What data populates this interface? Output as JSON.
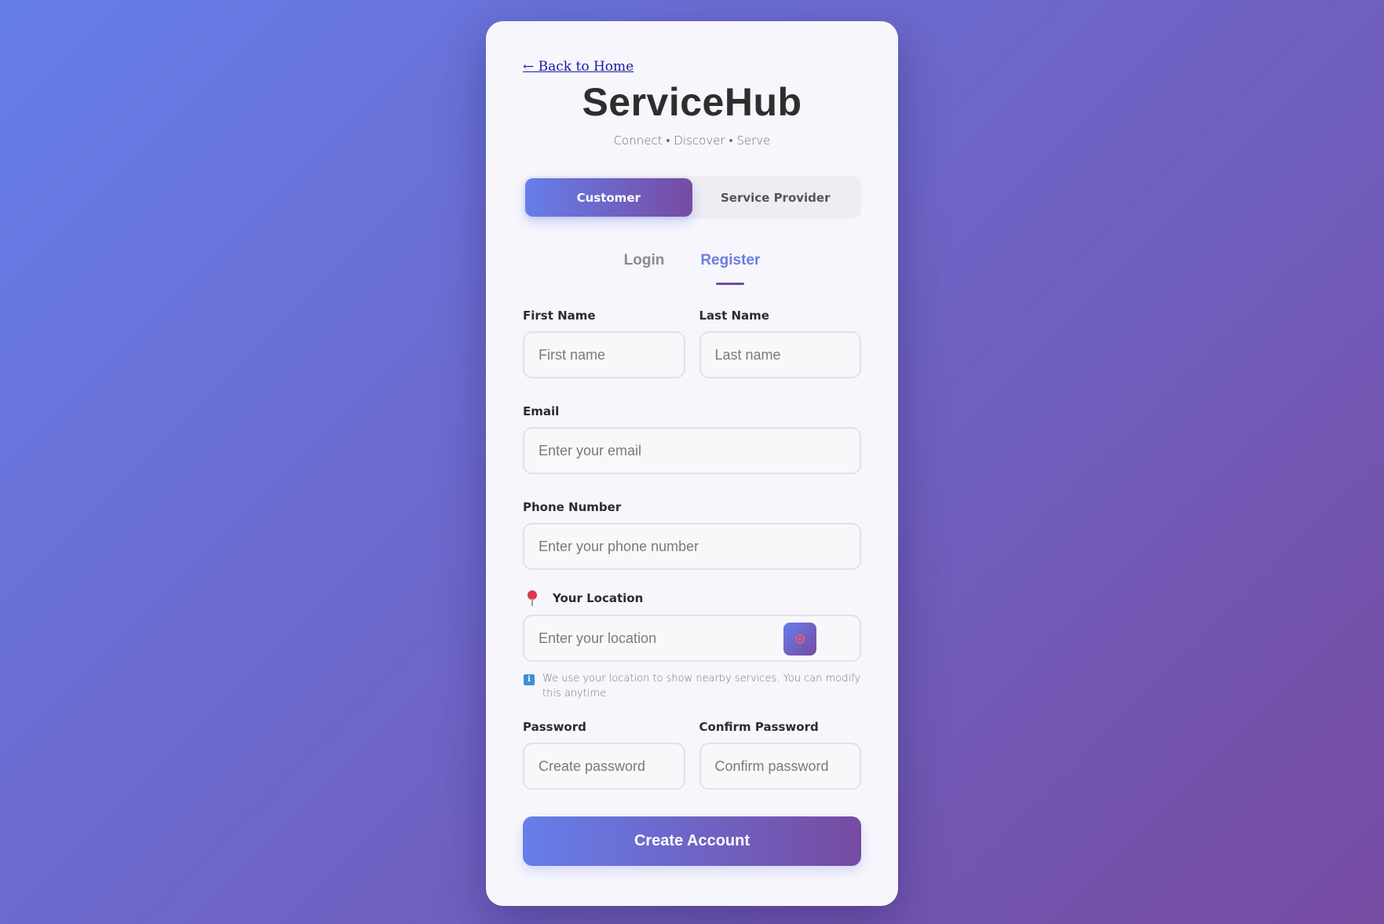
{
  "nav": {
    "back_label": "← Back to Home"
  },
  "brand": {
    "name": "ServiceHub",
    "tagline": "Connect • Discover • Serve"
  },
  "role_toggle": {
    "options": [
      "Customer",
      "Service Provider"
    ],
    "selected": "Customer"
  },
  "auth_tabs": {
    "options": [
      "Login",
      "Register"
    ],
    "selected": "Register"
  },
  "form": {
    "first_name": {
      "label": "First Name",
      "placeholder": "First name"
    },
    "last_name": {
      "label": "Last Name",
      "placeholder": "Last name"
    },
    "email": {
      "label": "Email",
      "placeholder": "Enter your email"
    },
    "phone": {
      "label": "Phone Number",
      "placeholder": "Enter your phone number"
    },
    "location": {
      "label": "Your Location",
      "placeholder": "Enter your location",
      "hint": "We use your location to show nearby services. You can modify this anytime."
    },
    "password": {
      "label": "Password",
      "placeholder": "Create password"
    },
    "confirm_password": {
      "label": "Confirm Password",
      "placeholder": "Confirm password"
    },
    "submit_label": "Create Account"
  },
  "colors": {
    "gradient_start": "#667eea",
    "gradient_end": "#764ba2",
    "active_tab": "#6a7de0"
  },
  "icons": {
    "location_label": "pin-icon",
    "locate_button": "target-icon",
    "hint": "info-icon"
  }
}
